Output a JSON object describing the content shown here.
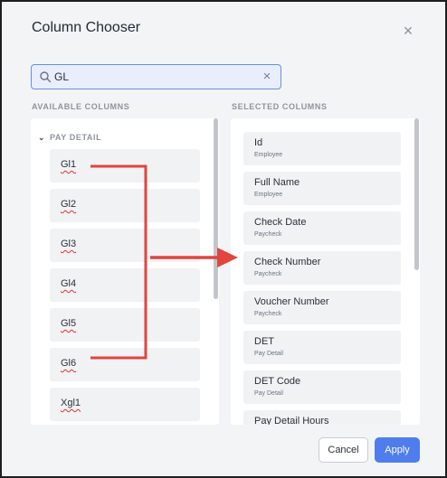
{
  "dialog": {
    "title": "Column Chooser",
    "close_icon": "close-icon"
  },
  "search": {
    "value": "GL",
    "placeholder": "",
    "icon": "search-icon",
    "clear_icon": "clear-icon"
  },
  "available": {
    "header": "AVAILABLE COLUMNS",
    "group": {
      "label": "PAY DETAIL",
      "icon": "chevron-down-icon"
    },
    "items": [
      {
        "label": "Gl1"
      },
      {
        "label": "Gl2"
      },
      {
        "label": "Gl3"
      },
      {
        "label": "Gl4"
      },
      {
        "label": "Gl5"
      },
      {
        "label": "Gl6"
      },
      {
        "label": "Xgl1"
      }
    ]
  },
  "selected": {
    "header": "SELECTED COLUMNS",
    "items": [
      {
        "label": "Id",
        "source": "Employee"
      },
      {
        "label": "Full Name",
        "source": "Employee"
      },
      {
        "label": "Check Date",
        "source": "Paycheck"
      },
      {
        "label": "Check Number",
        "source": "Paycheck"
      },
      {
        "label": "Voucher Number",
        "source": "Paycheck"
      },
      {
        "label": "DET",
        "source": "Pay Detail"
      },
      {
        "label": "DET Code",
        "source": "Pay Detail"
      },
      {
        "label": "Pay Detail Hours",
        "source": ""
      }
    ]
  },
  "footer": {
    "cancel_label": "Cancel",
    "apply_label": "Apply"
  },
  "colors": {
    "accent": "#4f7ded",
    "annotation": "#e0453f"
  }
}
